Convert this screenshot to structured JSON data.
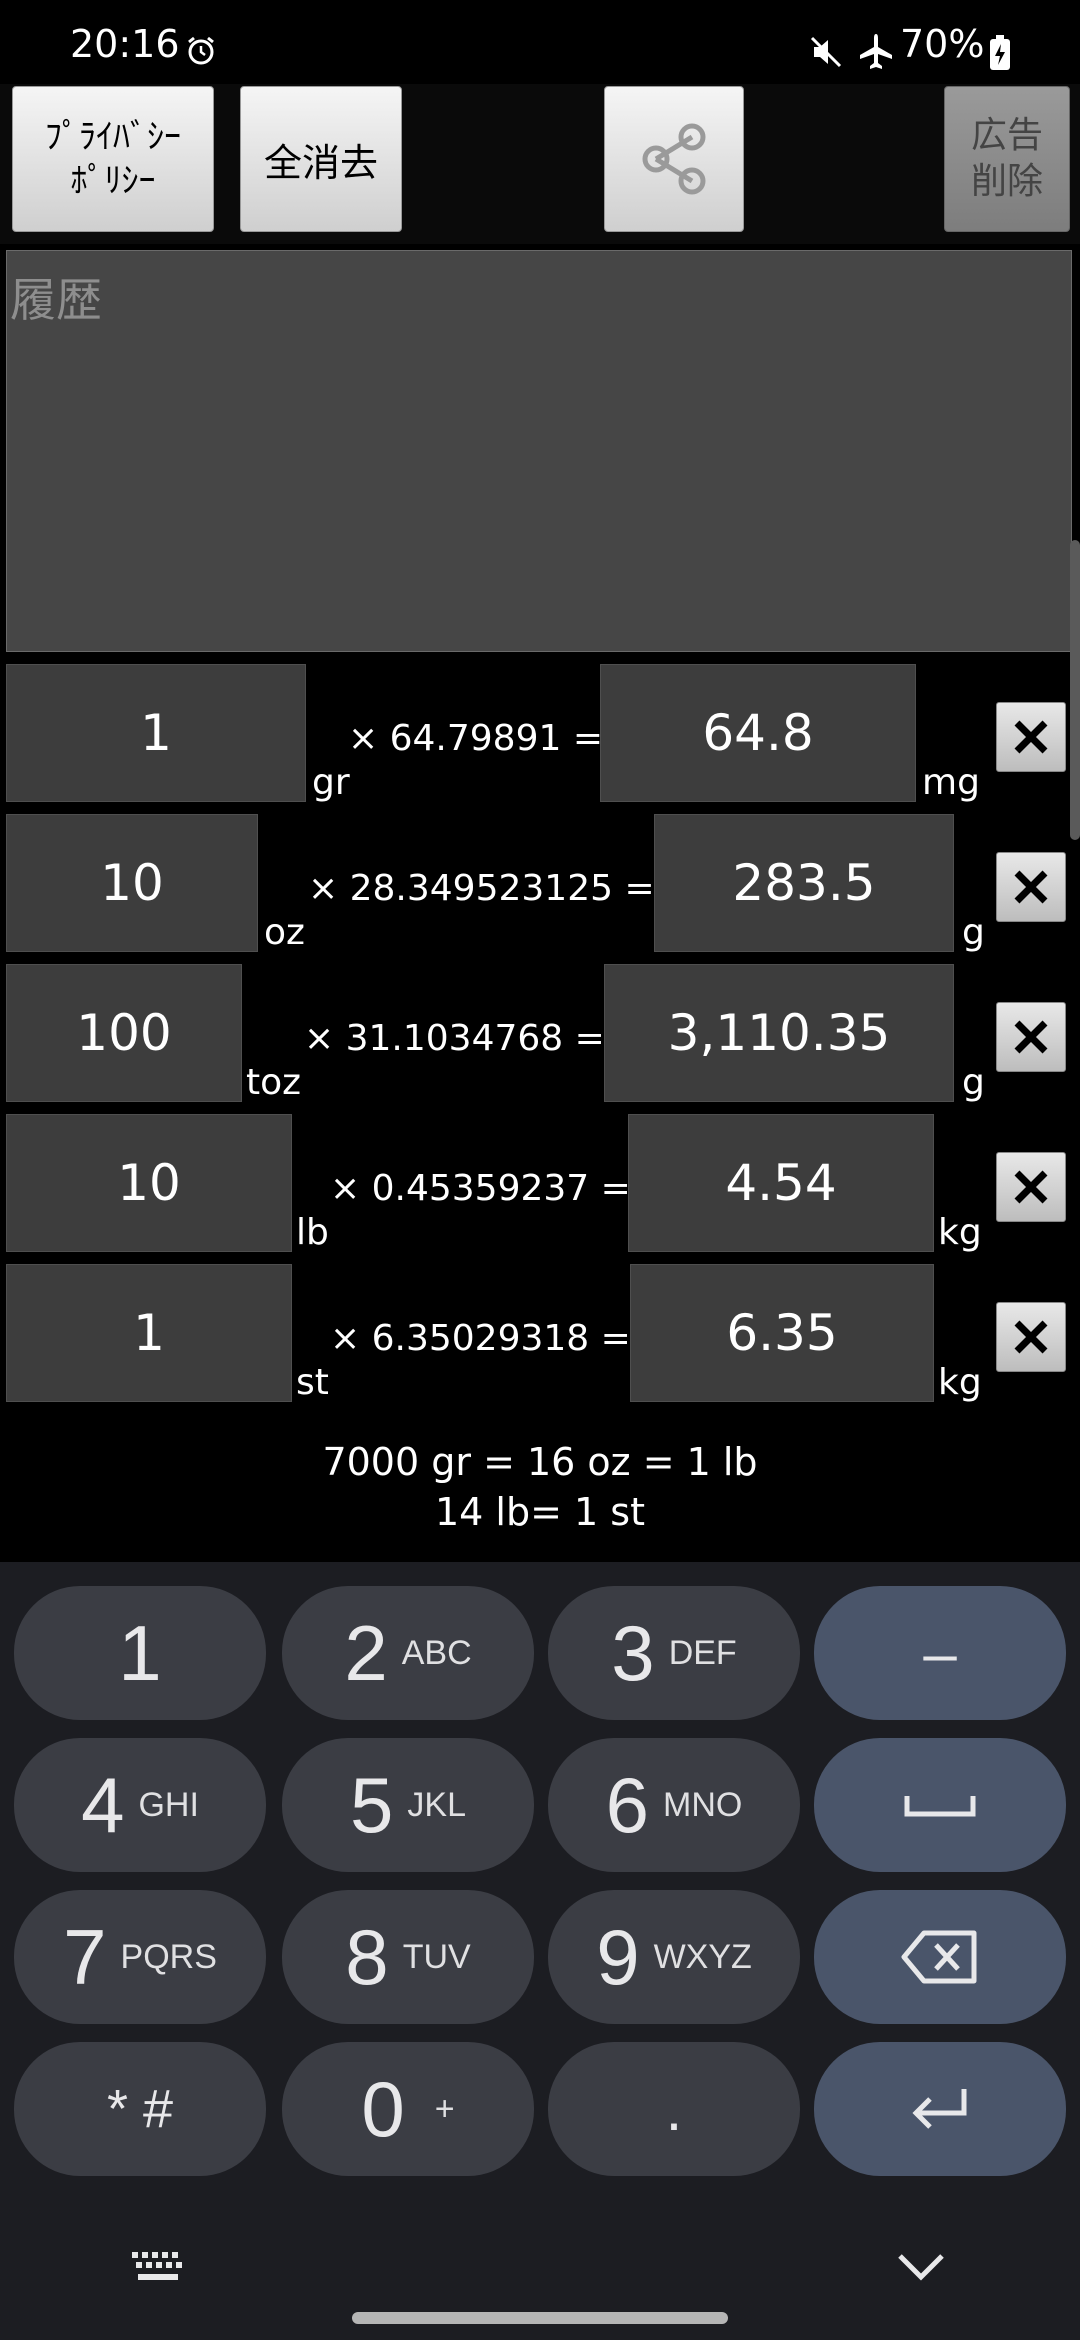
{
  "status_bar": {
    "time": "20:16",
    "battery": "70%"
  },
  "toolbar": {
    "privacy_line1": "ﾌﾟﾗｲﾊﾞｼｰ",
    "privacy_line2": "ﾎﾟﾘｼｰ",
    "clear_all": "全消去",
    "remove_ads_line1": "広告",
    "remove_ads_line2": "削除"
  },
  "history": {
    "placeholder": "履歴"
  },
  "rows": [
    {
      "input": "1",
      "in_unit": "gr",
      "factor": "× 64.79891 =",
      "result": "64.8",
      "out_unit": "mg"
    },
    {
      "input": "10",
      "in_unit": "oz",
      "factor": "× 28.349523125 =",
      "result": "283.5",
      "out_unit": "g"
    },
    {
      "input": "100",
      "in_unit": "toz",
      "factor": "× 31.1034768 =",
      "result": "3,110.35",
      "out_unit": "g"
    },
    {
      "input": "10",
      "in_unit": "lb",
      "factor": "× 0.45359237 =",
      "result": "4.54",
      "out_unit": "kg"
    },
    {
      "input": "1",
      "in_unit": "st",
      "factor": "× 6.35029318 =",
      "result": "6.35",
      "out_unit": "kg"
    }
  ],
  "notes": {
    "line1": "7000 gr = 16 oz = 1 lb",
    "line2": "14 lb= 1 st"
  },
  "keyboard": {
    "keys": [
      {
        "main": "1",
        "sub": ""
      },
      {
        "main": "2",
        "sub": "ABC"
      },
      {
        "main": "3",
        "sub": "DEF"
      },
      {
        "main": "–",
        "sub": ""
      },
      {
        "main": "4",
        "sub": "GHI"
      },
      {
        "main": "5",
        "sub": "JKL"
      },
      {
        "main": "6",
        "sub": "MNO"
      },
      {
        "main": "space",
        "sub": ""
      },
      {
        "main": "7",
        "sub": "PQRS"
      },
      {
        "main": "8",
        "sub": "TUV"
      },
      {
        "main": "9",
        "sub": "WXYZ"
      },
      {
        "main": "backspace",
        "sub": ""
      },
      {
        "main": "* #",
        "sub": ""
      },
      {
        "main": "0",
        "sub": "+"
      },
      {
        "main": ".",
        "sub": ""
      },
      {
        "main": "enter",
        "sub": ""
      }
    ]
  }
}
